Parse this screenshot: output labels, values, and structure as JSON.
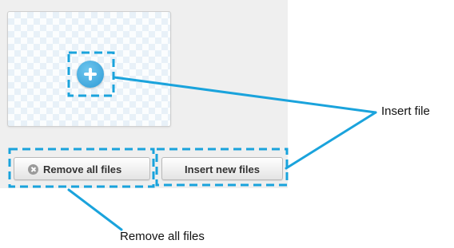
{
  "toolbar": {
    "remove_label": "Remove all files",
    "insert_label": "Insert new files"
  },
  "callouts": {
    "insert_file": "Insert file",
    "remove_all_files": "Remove all files"
  },
  "icons": {
    "add": "plus-circle-icon",
    "remove": "x-circle-icon"
  },
  "colors": {
    "highlight": "#1aa3dc",
    "accent": "#2d9bd6"
  }
}
